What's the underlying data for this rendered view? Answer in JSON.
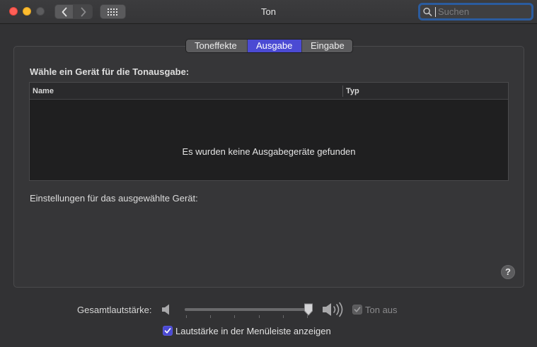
{
  "window": {
    "title": "Ton"
  },
  "search": {
    "placeholder": "Suchen",
    "value": ""
  },
  "tabs": [
    {
      "label": "Toneffekte",
      "active": false
    },
    {
      "label": "Ausgabe",
      "active": true
    },
    {
      "label": "Eingabe",
      "active": false
    }
  ],
  "output": {
    "heading": "Wähle ein Gerät für die Tonausgabe:",
    "columns": [
      "Name",
      "Typ"
    ],
    "empty_message": "Es wurden keine Ausgabegeräte gefunden",
    "settings_label": "Einstellungen für das ausgewählte Gerät:",
    "help_label": "?"
  },
  "volume": {
    "label": "Gesamtlautstärke:",
    "level": 0.97,
    "mute_label": "Ton aus",
    "mute_checked": true,
    "mute_enabled": false,
    "menubar_label": "Lautstärke in der Menüleiste anzeigen",
    "menubar_checked": true
  },
  "icons": {
    "back": "chevron-left-icon",
    "forward": "chevron-right-icon",
    "grid": "grid-icon",
    "search": "magnifier-icon",
    "speaker_low": "speaker-low-icon",
    "speaker_high": "speaker-high-icon"
  },
  "colors": {
    "accent": "#4b4ad3",
    "close": "#fe5f57",
    "minimize": "#febc2e",
    "search_focus": "#2b5c9f"
  }
}
